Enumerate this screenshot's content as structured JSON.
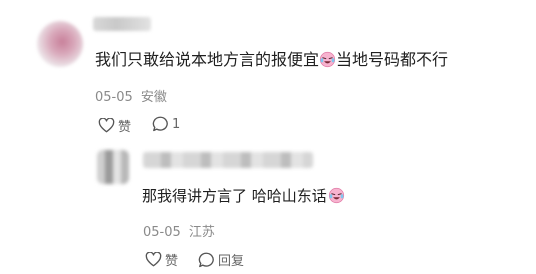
{
  "comment": {
    "username": "",
    "text_before_emoji": "我们只敢给说本地方言的报便宜",
    "emoji_name": "crying-laughing-face-emoji",
    "text_after_emoji": "当地号码都不行",
    "date": "05-05",
    "location": "安徽",
    "like_label": "赞",
    "reply_count": "1"
  },
  "reply": {
    "username": "",
    "text_before_emoji": "那我得讲方言了 哈哈山东话",
    "emoji_name": "crying-laughing-face-emoji",
    "date": "05-05",
    "location": "江苏",
    "like_label": "赞",
    "reply_label": "回复"
  },
  "colors": {
    "meta_gray": "#8a8a8a",
    "icon_gray": "#666666",
    "emoji_face": "#f6a9c8"
  }
}
